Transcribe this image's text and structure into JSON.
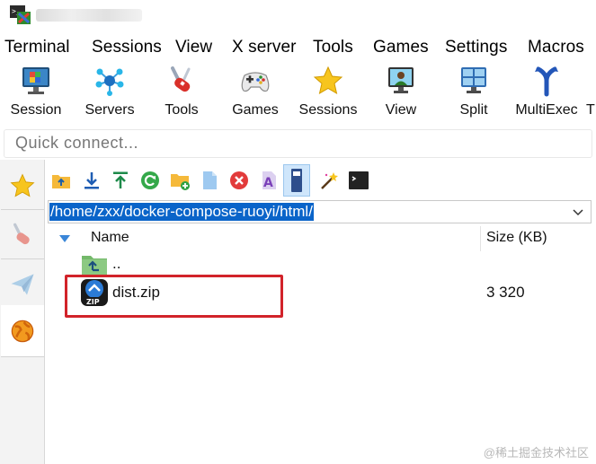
{
  "menu": [
    "Terminal",
    "Sessions",
    "View",
    "X server",
    "Tools",
    "Games",
    "Settings",
    "Macros"
  ],
  "toolbar": {
    "buttons": [
      {
        "label": "Session",
        "icon": "monitor-session-icon"
      },
      {
        "label": "Servers",
        "icon": "servers-network-icon"
      },
      {
        "label": "Tools",
        "icon": "swiss-knife-icon"
      },
      {
        "label": "Games",
        "icon": "gamepad-icon"
      },
      {
        "label": "Sessions",
        "icon": "star-icon"
      },
      {
        "label": "View",
        "icon": "user-monitor-icon"
      },
      {
        "label": "Split",
        "icon": "split-window-icon"
      },
      {
        "label": "MultiExec",
        "icon": "multiexec-fork-icon"
      }
    ],
    "clipped_next": "T"
  },
  "quick_connect": {
    "placeholder": "Quick connect..."
  },
  "side_tabs": [
    "star-icon",
    "tools-icon",
    "sftp-send-icon",
    "globe-icon"
  ],
  "sftp": {
    "tools": [
      "folder-up-icon",
      "download-icon",
      "upload-icon",
      "refresh-icon",
      "new-folder-icon",
      "new-file-icon",
      "delete-icon",
      "rename-icon",
      "follow-terminal-icon",
      "magic-wand-icon",
      "terminal-icon"
    ],
    "path": "/home/zxx/docker-compose-ruoyi/html/",
    "columns": {
      "name": "Name",
      "size": "Size (KB)"
    },
    "rows": [
      {
        "name": "..",
        "size": "",
        "icon": "parent-folder-icon"
      },
      {
        "name": "dist.zip",
        "size": "3 320",
        "icon": "zip-file-icon"
      }
    ]
  },
  "watermark": "@稀土掘金技术社区",
  "colors": {
    "path_highlight": "#0a64c9",
    "annotation_box": "#d2232a"
  }
}
